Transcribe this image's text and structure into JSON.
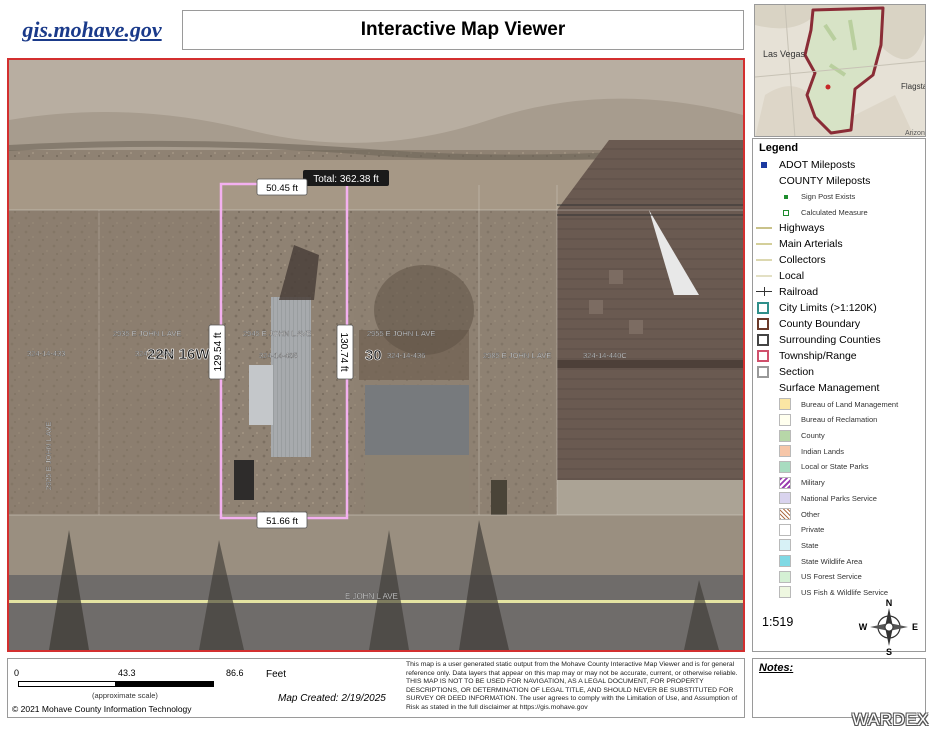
{
  "header": {
    "logo_text": "gis.mohave.gov",
    "title": "Interactive Map Viewer"
  },
  "overview_map": {
    "labels": [
      "Las Vegas",
      "Flagsta",
      "Arizon"
    ]
  },
  "map": {
    "total_label": "Total: 362.38 ft",
    "measurements": {
      "top": "50.45 ft",
      "left": "129.54 ft",
      "right": "130.74 ft",
      "bottom": "51.66 ft"
    },
    "addresses": [
      "2935 E JOHN L AVE",
      "2945 E JOHN L AVE",
      "2955 E JOHN L AVE",
      "2985 E JOHN L AVE",
      "2925 E JOHN L AVE"
    ],
    "parcels": [
      "324-14-433",
      "324-14-434",
      "324-14-435",
      "324-14-436",
      "324-14-440C"
    ],
    "township_label": "22N 16W",
    "section_label": "30",
    "street_label": "E JOHN L AVE",
    "colors": {
      "measure_line": "#f3b0f0",
      "frame": "#d32f2f",
      "road_line": "#e4e3a2"
    }
  },
  "legend": {
    "title": "Legend",
    "items": [
      {
        "label": "ADOT Mileposts",
        "size": "major",
        "symbol": "square",
        "color": "#1b3aa0"
      },
      {
        "label": "COUNTY Mileposts",
        "size": "heading",
        "symbol": "none"
      },
      {
        "label": "Sign Post Exists",
        "size": "minor",
        "symbol": "small-square",
        "color": "#1e8c2e"
      },
      {
        "label": "Calculated Measure",
        "size": "minor",
        "symbol": "dot-square",
        "color": "#1e8c2e"
      },
      {
        "label": "Highways",
        "size": "major",
        "symbol": "line",
        "color": "#c9c28a"
      },
      {
        "label": "Main Arterials",
        "size": "major",
        "symbol": "line",
        "color": "#d4cf9a"
      },
      {
        "label": "Collectors",
        "size": "major",
        "symbol": "line",
        "color": "#dcd8b0"
      },
      {
        "label": "Local",
        "size": "major",
        "symbol": "line",
        "color": "#e3e0c4"
      },
      {
        "label": "Railroad",
        "size": "major",
        "symbol": "rail",
        "color": "#333333"
      },
      {
        "label": "City Limits (>1:120K)",
        "size": "major",
        "symbol": "box",
        "color": "#2f8f8a"
      },
      {
        "label": "County Boundary",
        "size": "major",
        "symbol": "box",
        "color": "#6b3a2a"
      },
      {
        "label": "Surrounding Counties",
        "size": "major",
        "symbol": "box",
        "color": "#444444"
      },
      {
        "label": "Township/Range",
        "size": "major",
        "symbol": "box",
        "color": "#d0506c"
      },
      {
        "label": "Section",
        "size": "major",
        "symbol": "box",
        "color": "#999999"
      },
      {
        "label": "Surface Management",
        "size": "heading",
        "symbol": "none"
      },
      {
        "label": "Bureau of Land Management",
        "size": "minor",
        "symbol": "fill",
        "color": "#fbe6a4"
      },
      {
        "label": "Bureau of Reclamation",
        "size": "minor",
        "symbol": "fill",
        "color": "#ffffee"
      },
      {
        "label": "County",
        "size": "minor",
        "symbol": "fill",
        "color": "#b7d7a8"
      },
      {
        "label": "Indian Lands",
        "size": "minor",
        "symbol": "fill",
        "color": "#f6c6a8"
      },
      {
        "label": "Local or State Parks",
        "size": "minor",
        "symbol": "fill",
        "color": "#a8dcc0"
      },
      {
        "label": "Military",
        "size": "minor",
        "symbol": "hatch",
        "color": "#9a3db0"
      },
      {
        "label": "National Parks Service",
        "size": "minor",
        "symbol": "fill",
        "color": "#d9d3ee"
      },
      {
        "label": "Other",
        "size": "minor",
        "symbol": "hatch2",
        "color": "#b0704a"
      },
      {
        "label": "Private",
        "size": "minor",
        "symbol": "fill",
        "color": "#ffffff"
      },
      {
        "label": "State",
        "size": "minor",
        "symbol": "fill",
        "color": "#d7f1f6"
      },
      {
        "label": "State Wildlife Area",
        "size": "minor",
        "symbol": "fill",
        "color": "#7fd9e4"
      },
      {
        "label": "US Forest Service",
        "size": "minor",
        "symbol": "fill",
        "color": "#d4f0d4"
      },
      {
        "label": "US Fish & Wildlife Service",
        "size": "minor",
        "symbol": "fill",
        "color": "#eef7e0"
      }
    ]
  },
  "scale": {
    "ratio": "1:519",
    "ticks": [
      "0",
      "43.3",
      "86.6"
    ],
    "units": "Feet",
    "approx_note": "(approximate scale)"
  },
  "north_arrow": {
    "n": "N",
    "s": "S",
    "e": "E",
    "w": "W"
  },
  "footer": {
    "copyright": "© 2021 Mohave County Information Technology",
    "map_created": "Map Created: 2/19/2025",
    "disclaimer": "This map is a user generated static output from the Mohave County Interactive Map Viewer and is for general reference only. Data layers that appear on this map may or may not be accurate, current, or otherwise reliable. THIS MAP IS NOT TO BE USED FOR NAVIGATION, AS A LEGAL DOCUMENT, FOR PROPERTY DESCRIPTIONS, OR DETERMINATION OF LEGAL TITLE, AND SHOULD NEVER BE SUBSTITUTED FOR SURVEY OR DEED INFORMATION. The user agrees to comply with the Limitation of Use, and Assumption of Risk as stated in the full disclaimer at https://gis.mohave.gov"
  },
  "notes": {
    "label": "Notes:"
  },
  "watermark": "WARDEX"
}
